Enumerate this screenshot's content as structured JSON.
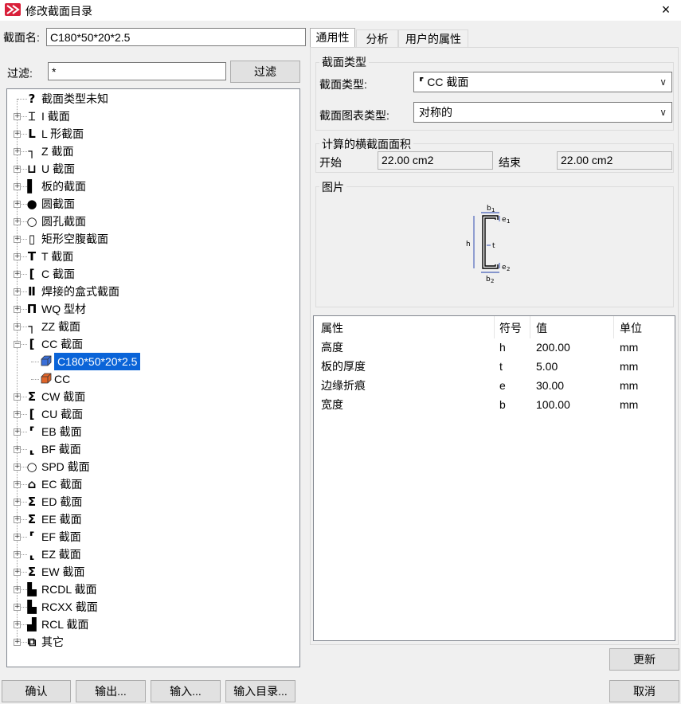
{
  "window": {
    "title": "修改截面目录",
    "close_icon": "×"
  },
  "section_name": {
    "label": "截面名:",
    "value": "C180*50*20*2.5"
  },
  "filter": {
    "label": "过滤:",
    "value": "*",
    "button": "过滤"
  },
  "tree": {
    "items": [
      {
        "label": "截面类型未知",
        "icon": "?",
        "expander": ""
      },
      {
        "label": "I 截面",
        "icon": "I",
        "expander": "+"
      },
      {
        "label": "L 形截面",
        "icon": "L",
        "expander": "+"
      },
      {
        "label": "Z 截面",
        "icon": "Z",
        "expander": "+"
      },
      {
        "label": "U 截面",
        "icon": "U",
        "expander": "+"
      },
      {
        "label": "板的截面",
        "icon": "plate",
        "expander": "+"
      },
      {
        "label": "圆截面",
        "icon": "●",
        "expander": "+"
      },
      {
        "label": "圆孔截面",
        "icon": "○",
        "expander": "+"
      },
      {
        "label": "矩形空腹截面",
        "icon": "▯",
        "expander": "+"
      },
      {
        "label": "T 截面",
        "icon": "T",
        "expander": "+"
      },
      {
        "label": "C 截面",
        "icon": "C",
        "expander": "+"
      },
      {
        "label": "焊接的盒式截面",
        "icon": "II",
        "expander": "+"
      },
      {
        "label": "WQ 型材",
        "icon": "WQ",
        "expander": "+"
      },
      {
        "label": "ZZ 截面",
        "icon": "ZZ",
        "expander": "+"
      },
      {
        "label": "CC 截面",
        "icon": "CC",
        "expander": "−"
      },
      {
        "label": "C180*50*20*2.5",
        "icon": "cube-blue",
        "expander": "",
        "child": true,
        "selected": true
      },
      {
        "label": "CC",
        "icon": "cube-orange",
        "expander": "",
        "child": true
      },
      {
        "label": "CW 截面",
        "icon": "Σ",
        "expander": "+"
      },
      {
        "label": "CU 截面",
        "icon": "CU",
        "expander": "+"
      },
      {
        "label": "EB 截面",
        "icon": "EB",
        "expander": "+"
      },
      {
        "label": "BF 截面",
        "icon": "BF",
        "expander": "+"
      },
      {
        "label": "SPD 截面",
        "icon": "SPD",
        "expander": "+"
      },
      {
        "label": "EC 截面",
        "icon": "EC",
        "expander": "+"
      },
      {
        "label": "ED 截面",
        "icon": "ED",
        "expander": "+"
      },
      {
        "label": "EE 截面",
        "icon": "EE",
        "expander": "+"
      },
      {
        "label": "EF 截面",
        "icon": "EF",
        "expander": "+"
      },
      {
        "label": "EZ 截面",
        "icon": "EZ",
        "expander": "+"
      },
      {
        "label": "EW 截面",
        "icon": "EW",
        "expander": "+"
      },
      {
        "label": "RCDL 截面",
        "icon": "RCDL",
        "expander": "+"
      },
      {
        "label": "RCXX 截面",
        "icon": "RCXX",
        "expander": "+"
      },
      {
        "label": "RCL 截面",
        "icon": "RCL",
        "expander": "+"
      },
      {
        "label": "其它",
        "icon": "other",
        "expander": "+"
      }
    ]
  },
  "tabs": [
    "通用性",
    "分析",
    "用户的属性"
  ],
  "section_type_group": {
    "title": "截面类型",
    "type_label": "截面类型:",
    "type_value": "CC 截面",
    "chart_type_label": "截面图表类型:",
    "chart_type_value": "对称的"
  },
  "area_group": {
    "title": "计算的横截面面积",
    "start_label": "开始",
    "start_value": "22.00 cm2",
    "end_label": "结束",
    "end_value": "22.00 cm2"
  },
  "picture_group": {
    "title": "图片",
    "labels": {
      "b1": "b",
      "b1_sub": "1",
      "e1": "e",
      "e1_sub": "1",
      "h": "h",
      "t": "t",
      "e2": "e",
      "e2_sub": "2",
      "b2": "b",
      "b2_sub": "2"
    }
  },
  "properties": {
    "headers": [
      "属性",
      "符号",
      "值",
      "单位"
    ],
    "rows": [
      [
        "高度",
        "h",
        "200.00",
        "mm"
      ],
      [
        "板的厚度",
        "t",
        "5.00",
        "mm"
      ],
      [
        "边缘折痕",
        "e",
        "30.00",
        "mm"
      ],
      [
        "宽度",
        "b",
        "100.00",
        "mm"
      ]
    ]
  },
  "buttons": {
    "update": "更新",
    "confirm": "确认",
    "export": "输出...",
    "import": "输入...",
    "import_catalog": "输入目录...",
    "cancel": "取消"
  }
}
